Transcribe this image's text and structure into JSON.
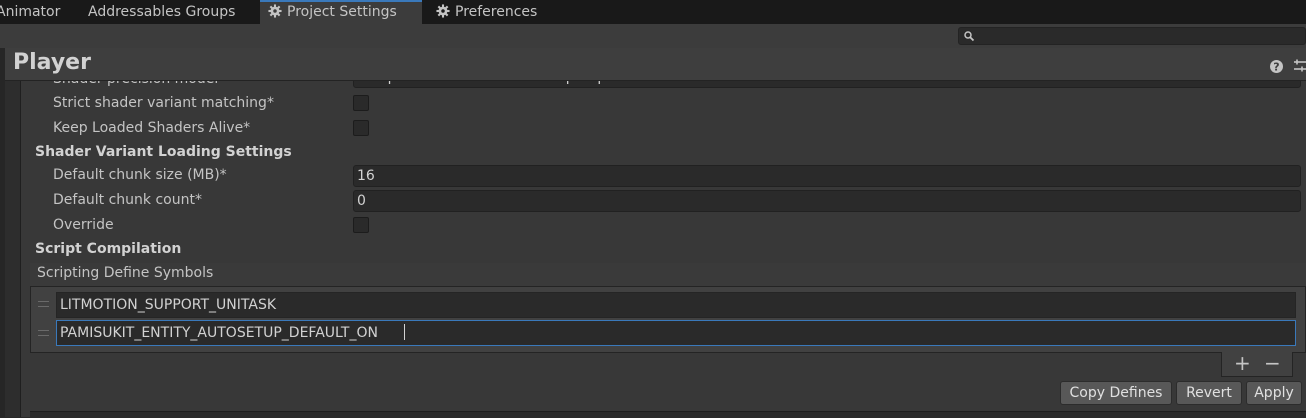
{
  "tabs": [
    {
      "label": "Animator",
      "active": false
    },
    {
      "label": "Addressables Groups",
      "active": false
    },
    {
      "label": "Project Settings",
      "active": true,
      "icon": "gear-icon"
    },
    {
      "label": "Preferences",
      "active": false,
      "icon": "gear-icon"
    }
  ],
  "search": {
    "placeholder": "",
    "value": ""
  },
  "panel": {
    "title": "Player"
  },
  "rows": {
    "shader_precision_label": "Shader precision model",
    "shader_precision_value": "Use platform defaults for sampler precision",
    "strict_variant_label": "Strict shader variant matching*",
    "keep_loaded_label": "Keep Loaded Shaders Alive*"
  },
  "shader_variant": {
    "section_title": "Shader Variant Loading Settings",
    "chunk_size_label": "Default chunk size (MB)*",
    "chunk_size_value": "16",
    "chunk_count_label": "Default chunk count*",
    "chunk_count_value": "0",
    "override_label": "Override"
  },
  "script_compilation": {
    "section_title": "Script Compilation",
    "list_header": "Scripting Define Symbols",
    "symbols": [
      "LITMOTION_SUPPORT_UNITASK",
      "PAMISUKIT_ENTITY_AUTOSETUP_DEFAULT_ON"
    ],
    "add_label": "+",
    "remove_label": "−"
  },
  "buttons": {
    "copy_defines": "Copy Defines",
    "revert": "Revert",
    "apply": "Apply"
  },
  "colors": {
    "accent": "#3a79bb",
    "background": "#282828",
    "field": "#2a2a2a"
  }
}
